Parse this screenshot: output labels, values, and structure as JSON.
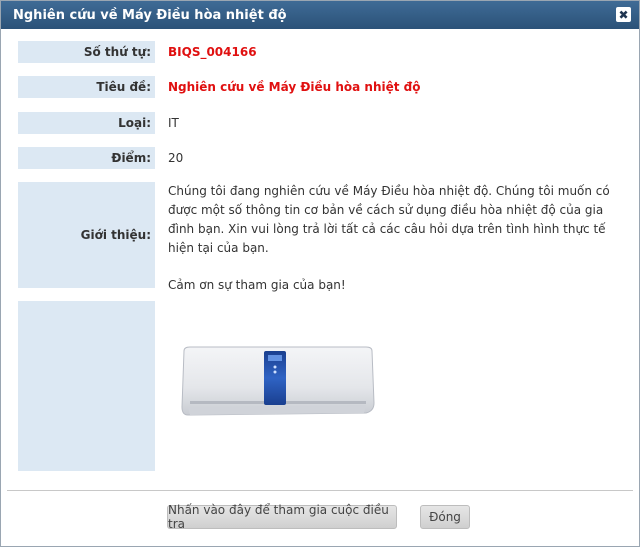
{
  "dialog": {
    "title": "Nghiên cứu về Máy Điều hòa nhiệt độ",
    "close_symbol": "✖"
  },
  "fields": {
    "serial_label": "Số thứ tự:",
    "serial_value": "BIQS_004166",
    "title_label": "Tiêu đề:",
    "title_value": "Nghiên cứu về Máy Điều hòa nhiệt độ",
    "type_label": "Loại:",
    "type_value": "IT",
    "points_label": "Điểm:",
    "points_value": "20",
    "intro_label": "Giới thiệu:",
    "intro_paragraph_1": "Chúng tôi đang nghiên cứu về Máy Điều hòa nhiệt độ. Chúng tôi muốn có được một số thông tin cơ bản về cách sử dụng điều hòa nhiệt độ của gia đình bạn. Xin vui lòng trả lời tất cả các câu hỏi dựa trên tình hình thực tế hiện tại của bạn.",
    "intro_paragraph_2": "Cảm ơn sự tham gia của bạn!"
  },
  "buttons": {
    "join_label": "Nhấn vào đây để tham gia cuộc điều tra",
    "close_label": "Đóng"
  },
  "colors": {
    "titlebar": "#2b5278",
    "label_bg": "#dce8f3",
    "highlight_red": "#e01010"
  },
  "icons": {
    "close": "close-icon",
    "product": "air-conditioner-image"
  }
}
